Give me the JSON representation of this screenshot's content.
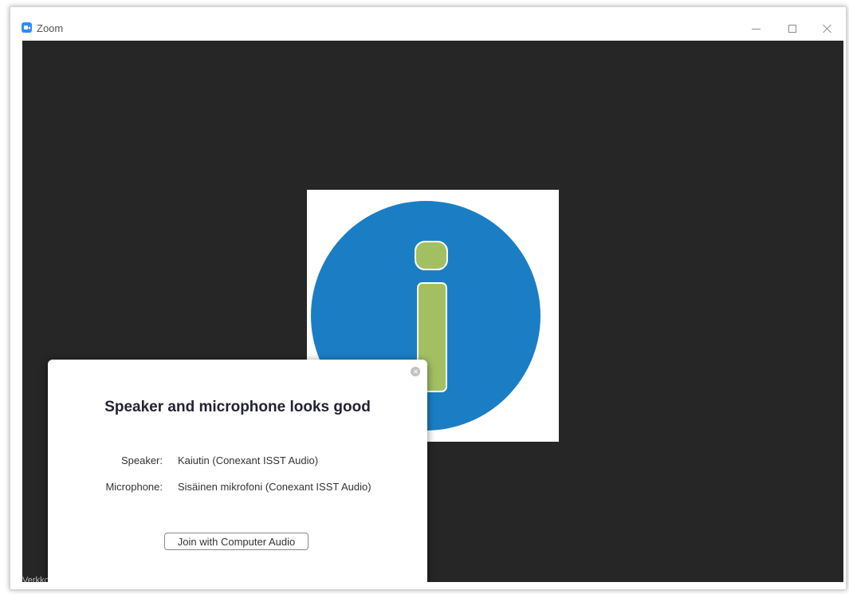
{
  "window": {
    "title": "Zoom",
    "controls": {
      "minimize": "minimize",
      "maximize": "maximize",
      "close": "close"
    }
  },
  "meeting": {
    "status_text": "Verkkokouluttajat Sähköinfo Oy",
    "tile_icon": "info-icon",
    "tile_colors": {
      "circle": "#1b7ec5",
      "glyph": "#a2c062"
    }
  },
  "audio_dialog": {
    "title": "Speaker and microphone looks good",
    "speaker": {
      "label": "Speaker:",
      "value": "Kaiutin (Conexant ISST Audio)"
    },
    "microphone": {
      "label": "Microphone:",
      "value": "Sisäinen mikrofoni (Conexant ISST Audio)"
    },
    "join_button_label": "Join with Computer Audio"
  }
}
